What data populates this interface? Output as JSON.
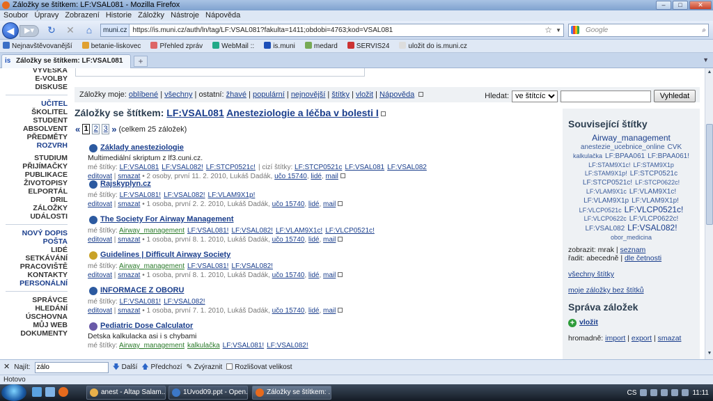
{
  "window": {
    "title": "Záložky se štítkem: LF:VSAL081 - Mozilla Firefox"
  },
  "menu": [
    "Soubor",
    "Úpravy",
    "Zobrazení",
    "Historie",
    "Záložky",
    "Nástroje",
    "Nápověda"
  ],
  "nav": {
    "site": "muni.cz",
    "url": "https://is.muni.cz/auth/ln/tag/LF:VSAL081?fakulta=1411;obdobi=4763;kod=VSAL081",
    "search_placeholder": "Google"
  },
  "bookmarks": [
    "Nejnavštěvovanější",
    "betanie-liskovec",
    "Přehled zpráv",
    "WebMail ::",
    "is.muni",
    "medard",
    "SERVIS24",
    "uložit do is.muni.cz"
  ],
  "tab": {
    "label": "Záložky se štítkem: LF:VSAL081"
  },
  "leftnav": [
    {
      "t": "Vyvěska",
      "hl": false
    },
    {
      "t": "e-volby",
      "hl": false
    },
    {
      "t": "Diskuse",
      "hl": false
    },
    {
      "sep": true
    },
    {
      "t": "Učitel",
      "hl": true
    },
    {
      "t": "Školitel",
      "hl": false
    },
    {
      "t": "Student",
      "hl": false
    },
    {
      "t": "Absolvent",
      "hl": false
    },
    {
      "t": "Předměty",
      "hl": false
    },
    {
      "t": "Rozvrh",
      "hl": true
    },
    {
      "gap": true
    },
    {
      "t": "Studium",
      "hl": false
    },
    {
      "t": "Přijímačky",
      "hl": false
    },
    {
      "t": "Publikace",
      "hl": false
    },
    {
      "t": "Životopisy",
      "hl": false
    },
    {
      "t": "Elportál",
      "hl": false
    },
    {
      "t": "Dril",
      "hl": false
    },
    {
      "t": "Záložky",
      "hl": false
    },
    {
      "t": "Události",
      "hl": false
    },
    {
      "sep": true
    },
    {
      "t": "Nový dopis",
      "hl": true
    },
    {
      "t": "Pošta",
      "hl": true
    },
    {
      "t": "Lidé",
      "hl": false
    },
    {
      "t": "Setkávání",
      "hl": false
    },
    {
      "t": "Pracoviště",
      "hl": false
    },
    {
      "t": "Kontakty",
      "hl": false
    },
    {
      "t": "Personální",
      "hl": true
    },
    {
      "sep": true
    },
    {
      "t": "Správce",
      "hl": false
    },
    {
      "t": "Hledání",
      "hl": false
    },
    {
      "t": "Úschovna",
      "hl": false
    },
    {
      "t": "Můj web",
      "hl": false
    },
    {
      "t": "Dokumenty",
      "hl": false
    }
  ],
  "bmbar": {
    "prefix": "Záložky moje:",
    "mine": [
      "oblíbené",
      "všechny"
    ],
    "other_prefix": "ostatní:",
    "other": [
      "žhavé",
      "populární",
      "nejnovější",
      "štítky",
      "vložit",
      "Nápověda"
    ],
    "search_label": "Hledat:",
    "select_value": "ve štítcích",
    "button": "Vyhledat"
  },
  "heading": {
    "prefix": "Záložky se štítkem:",
    "tag": "LF:VSAL081",
    "course": "Anesteziologie a léčba v bolesti I"
  },
  "pager": {
    "pages": [
      "1",
      "2",
      "3"
    ],
    "total": "(celkem 25 záložek)"
  },
  "items": [
    {
      "title": "Základy anesteziologie",
      "icon_color": "#2c5aa0",
      "desc": "Multimediální skriptum z lf3.cuni.cz.",
      "mine_label": "mé štítky:",
      "tags": [
        "LF:VSAL081",
        "LF:VSAL082!",
        "LF:STCP0521c!"
      ],
      "other_label": "cizí štítky:",
      "other_tags": [
        "LF:STCP0521c",
        "LF:VSAL081",
        "LF:VSAL082"
      ],
      "meta": "• 2 osoby, první 11. 2. 2010, Lukáš Dadák,",
      "uco": "učo 15740"
    },
    {
      "title": "Rajskyplyn.cz",
      "icon_color": "#2c5aa0",
      "desc": "",
      "mine_label": "mé štítky:",
      "tags": [
        "LF:VSAL081!",
        "LF:VSAL082!",
        "LF:VLAM9X1p!"
      ],
      "other_label": "",
      "other_tags": [],
      "meta": "• 1 osoba, první 2. 2. 2010, Lukáš Dadák,",
      "uco": "učo 15740"
    },
    {
      "title": "The Society For Airway Management",
      "icon_color": "#2c5aa0",
      "desc": "",
      "mine_label": "mé štítky:",
      "tags": [
        "Airway_management",
        "LF:VSAL081!",
        "LF:VSAL082!",
        "LF:VLAM9X1c!",
        "LF:VLCP0521c!"
      ],
      "other_label": "",
      "other_tags": [],
      "meta": "• 1 osoba, první 8. 1. 2010, Lukáš Dadák,",
      "uco": "učo 15740"
    },
    {
      "title": "Guidelines | Difficult Airway Society",
      "icon_color": "#c9a227",
      "desc": "",
      "mine_label": "mé štítky:",
      "tags": [
        "Airway_management",
        "LF:VSAL081!",
        "LF:VSAL082!"
      ],
      "other_label": "",
      "other_tags": [],
      "meta": "• 1 osoba, první 8. 1. 2010, Lukáš Dadák,",
      "uco": "učo 15740"
    },
    {
      "title": "INFORMACE Z OBORU",
      "icon_color": "#2c5aa0",
      "desc": "",
      "mine_label": "mé štítky:",
      "tags": [
        "LF:VSAL081!",
        "LF:VSAL082!"
      ],
      "other_label": "",
      "other_tags": [],
      "meta": "• 1 osoba, první 7. 1. 2010, Lukáš Dadák,",
      "uco": "učo 15740"
    },
    {
      "title": "Pediatric Dose Calculator",
      "icon_color": "#6a5aa8",
      "desc": "Detska kalkulacka asi i s chybami",
      "mine_label": "mé štítky:",
      "tags": [
        "Airway_management",
        "kalkulačka",
        "LF:VSAL081!",
        "LF:VSAL082!"
      ],
      "other_label": "",
      "other_tags": [],
      "meta": "",
      "uco": ""
    }
  ],
  "item_actions": {
    "edit": "editovat",
    "delete": "smazat",
    "people": "lidé",
    "mail": "mail"
  },
  "related": {
    "title": "Související štítky",
    "cloud": [
      {
        "t": "Airway_management",
        "s": 12
      },
      {
        "t": "anestezie_ucebnice_online",
        "s": 10
      },
      {
        "t": "CVK",
        "s": 10
      },
      {
        "t": "kalkulačka",
        "s": 9
      },
      {
        "t": "LF:BPAA061",
        "s": 10
      },
      {
        "t": "LF:BPAA061!",
        "s": 10
      },
      {
        "t": "LF:STAM9X1c!",
        "s": 9
      },
      {
        "t": "LF:STAM9X1p",
        "s": 9
      },
      {
        "t": "LF:STAM9X1p!",
        "s": 9
      },
      {
        "t": "LF:STCP0521c",
        "s": 10
      },
      {
        "t": "LF:STCP0521c!",
        "s": 10
      },
      {
        "t": "LF:STCP0622c!",
        "s": 9
      },
      {
        "t": "LF:VLAM9X1c",
        "s": 9
      },
      {
        "t": "LF:VLAM9X1c!",
        "s": 10
      },
      {
        "t": "LF:VLAM9X1p",
        "s": 10
      },
      {
        "t": "LF:VLAM9X1p!",
        "s": 10
      },
      {
        "t": "LF:VLCP0521c",
        "s": 9
      },
      {
        "t": "LF:VLCP0521c!",
        "s": 12
      },
      {
        "t": "LF:VLCP0622c",
        "s": 9
      },
      {
        "t": "LF:VLCP0622c!",
        "s": 10
      },
      {
        "t": "LF:VSAL082",
        "s": 10
      },
      {
        "t": "LF:VSAL082!",
        "s": 12
      },
      {
        "t": "obor_medicina",
        "s": 9
      }
    ],
    "show_label": "zobrazit:",
    "show_current": "mrak",
    "show_other": "seznam",
    "sort_label": "řadit:",
    "sort_current": "abecedně",
    "sort_other": "dle četnosti",
    "all_tags": "všechny štítky",
    "no_tags": "moje záložky bez štítků"
  },
  "manage": {
    "title": "Správa záložek",
    "insert": "vložit",
    "bulk_label": "hromadně:",
    "bulk": [
      "import",
      "export",
      "smazat"
    ]
  },
  "findbar": {
    "label": "Najít:",
    "value": "zálo",
    "next": "Další",
    "prev": "Předchozí",
    "highlight": "Zvýraznit",
    "case": "Rozlišovat velikost"
  },
  "status": "Hotovo",
  "taskbar": {
    "tasks": [
      "anest - Altap Salam...",
      "1Uvod09.ppt - Open...",
      "Záložky se štítkem: ..."
    ],
    "lang": "CS",
    "time": "11:11"
  }
}
